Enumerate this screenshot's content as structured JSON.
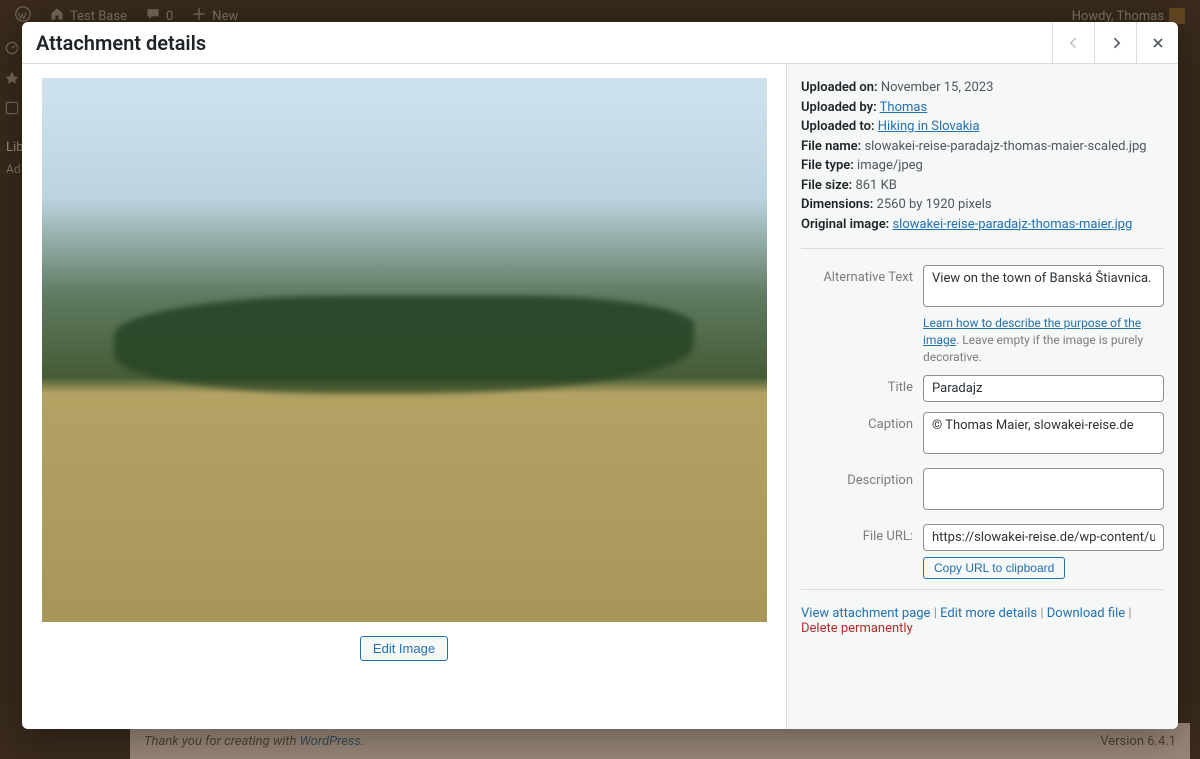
{
  "adminbar": {
    "site_name": "Test Base",
    "comments_count": "0",
    "new_label": "New",
    "howdy": "Howdy, Thomas"
  },
  "footer": {
    "thanks": "Thank you for creating with ",
    "wp_link": "WordPress",
    "period": ".",
    "version": "Version 6.4.1"
  },
  "sidemenu": {
    "lib": "Lib",
    "ad": "Ad"
  },
  "modal": {
    "title": "Attachment details",
    "edit_image": "Edit Image"
  },
  "meta": {
    "uploaded_on_label": "Uploaded on:",
    "uploaded_on": "November 15, 2023",
    "uploaded_by_label": "Uploaded by:",
    "uploaded_by": "Thomas",
    "uploaded_to_label": "Uploaded to:",
    "uploaded_to": "Hiking in Slovakia",
    "file_name_label": "File name:",
    "file_name": "slowakei-reise-paradajz-thomas-maier-scaled.jpg",
    "file_type_label": "File type:",
    "file_type": "image/jpeg",
    "file_size_label": "File size:",
    "file_size": "861 KB",
    "dimensions_label": "Dimensions:",
    "dimensions": "2560 by 1920 pixels",
    "original_image_label": "Original image:",
    "original_image": "slowakei-reise-paradajz-thomas-maier.jpg"
  },
  "fields": {
    "alt_label": "Alternative Text",
    "alt_value": "View on the town of Banská Štiavnica.",
    "alt_hint_link": "Learn how to describe the purpose of the image",
    "alt_hint_rest": ". Leave empty if the image is purely decorative.",
    "title_label": "Title",
    "title_value": "Paradajz",
    "caption_label": "Caption",
    "caption_value": "© Thomas Maier, slowakei-reise.de",
    "description_label": "Description",
    "description_value": "",
    "file_url_label": "File URL:",
    "file_url_value": "https://slowakei-reise.de/wp-content/upload",
    "copy_btn": "Copy URL to clipboard"
  },
  "actions": {
    "view": "View attachment page",
    "edit": "Edit more details",
    "download": "Download file",
    "delete": "Delete permanently",
    "sep": " | "
  }
}
